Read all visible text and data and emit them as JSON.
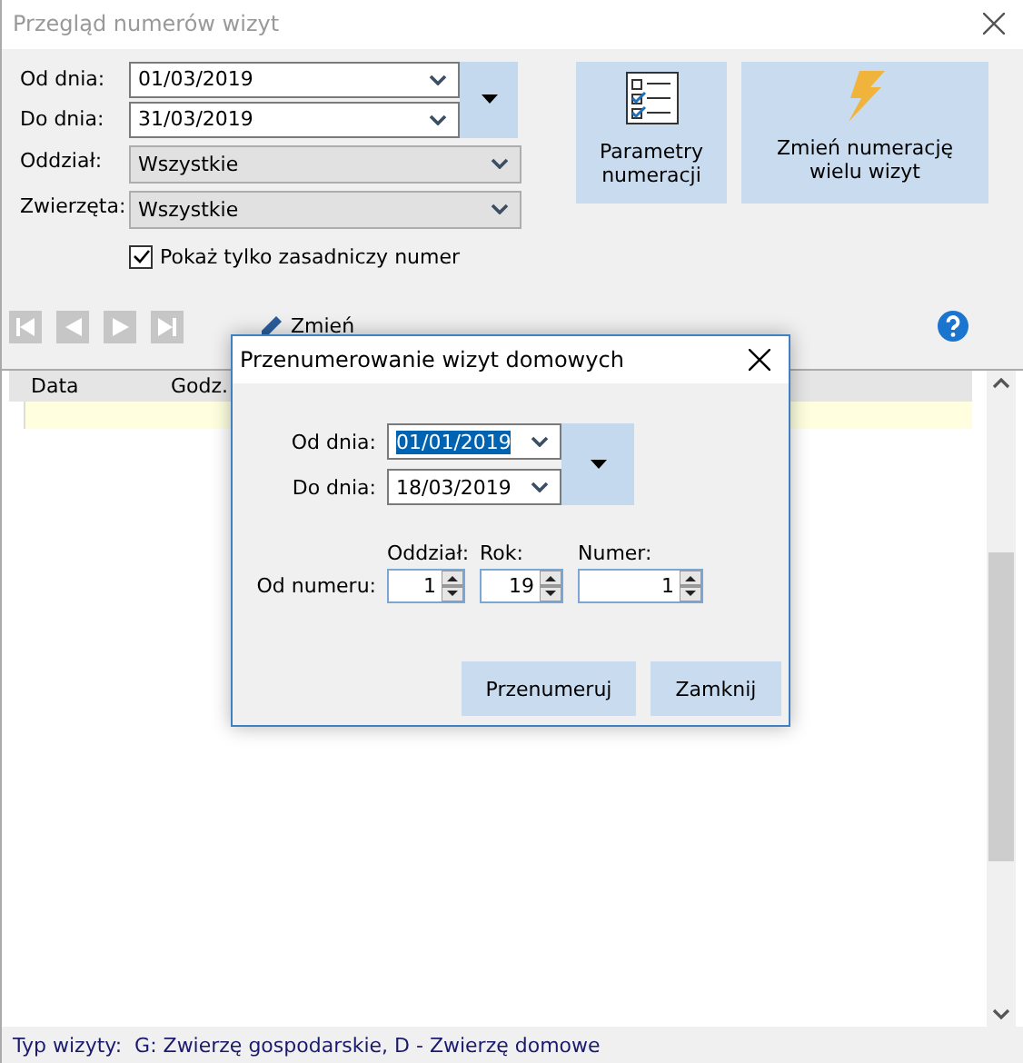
{
  "window": {
    "title": "Przegląd numerów wizyt"
  },
  "filter": {
    "date_from": {
      "label": "Od dnia:",
      "value": "01/03/2019"
    },
    "date_to": {
      "label": "Do dnia:",
      "value": "31/03/2019"
    },
    "branch": {
      "label": "Oddział:",
      "value": "Wszystkie"
    },
    "animals": {
      "label": "Zwierzęta:",
      "value": "Wszystkie"
    },
    "only_main_number": {
      "label": "Pokaż tylko zasadniczy numer",
      "checked": true
    }
  },
  "actions": [
    {
      "kind": "checklist",
      "label": "Parametry numeracji"
    },
    {
      "kind": "bolt",
      "label": "Zmień numerację wielu wizyt"
    }
  ],
  "toolbar": {
    "nav": [
      {
        "kind": "first"
      },
      {
        "kind": "prev"
      },
      {
        "kind": "next"
      },
      {
        "kind": "last"
      }
    ],
    "edit_label": "Zmień"
  },
  "table": {
    "columns": [
      "Data",
      "Godz."
    ]
  },
  "dialog": {
    "title": "Przenumerowanie wizyt domowych",
    "date_from": {
      "label": "Od dnia:",
      "value": "01/01/2019",
      "text_selected": true
    },
    "date_to": {
      "label": "Do dnia:",
      "value": "18/03/2019",
      "text_selected": false
    },
    "number": {
      "label": "Od numeru:",
      "fields": [
        {
          "label": "Oddział:",
          "value": "1"
        },
        {
          "label": "Rok:",
          "value": "19"
        },
        {
          "label": "Numer:",
          "value": "1"
        }
      ]
    },
    "buttons": [
      "Przenumeruj",
      "Zamknij"
    ]
  },
  "status_bar": {
    "text": "Typ wizyty:  G: Zwierzę gospodarskie, D - Zwierzę domowe"
  }
}
